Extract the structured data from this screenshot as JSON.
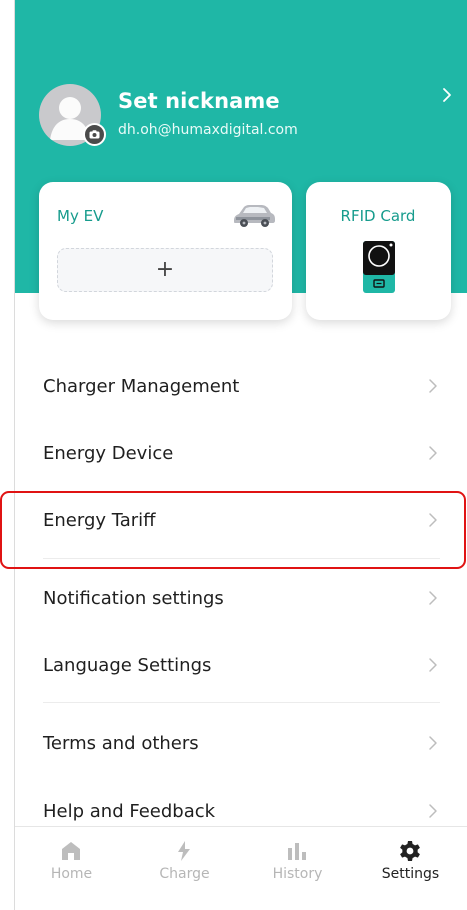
{
  "profile": {
    "nickname": "Set nickname",
    "email": "dh.oh@humaxdigital.com",
    "avatar_icon": "user-placeholder-icon",
    "camera_icon": "camera-icon",
    "chevron_icon": "chevron-right-icon"
  },
  "cards": {
    "my_ev": {
      "title": "My EV",
      "add_label": "+",
      "icon": "car-icon"
    },
    "rfid_card": {
      "title": "RFID Card",
      "icon": "rfid-card-icon"
    }
  },
  "menu": {
    "items": [
      {
        "label": "Charger Management"
      },
      {
        "label": "Energy Device"
      },
      {
        "label": "Energy Tariff"
      },
      {
        "label": "Notification settings"
      },
      {
        "label": "Language Settings"
      },
      {
        "label": "Terms and others"
      },
      {
        "label": "Help and Feedback"
      }
    ]
  },
  "bottom_nav": {
    "items": [
      {
        "label": "Home",
        "icon": "home-icon",
        "active": false
      },
      {
        "label": "Charge",
        "icon": "bolt-icon",
        "active": false
      },
      {
        "label": "History",
        "icon": "bar-chart-icon",
        "active": false
      },
      {
        "label": "Settings",
        "icon": "gear-icon",
        "active": true
      }
    ]
  },
  "colors": {
    "accent": "#1fb7a6",
    "accent_text": "#179c8d",
    "highlight": "#e01313"
  }
}
